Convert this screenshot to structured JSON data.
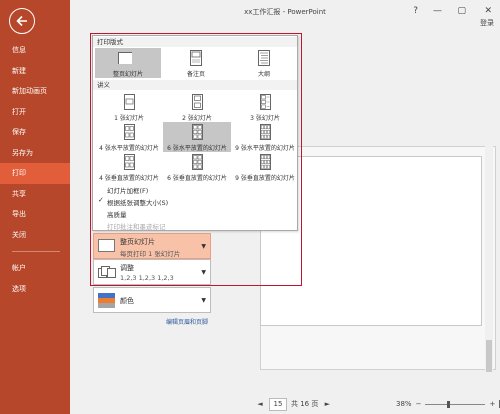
{
  "window": {
    "title": "xx工作汇报 - PowerPoint",
    "help": "?",
    "minimize": "—",
    "restore": "▢",
    "close": "✕",
    "login": "登录"
  },
  "sidebar": {
    "back_icon": "back-arrow-icon",
    "items": [
      "信息",
      "新建",
      "新加动画页",
      "打开",
      "保存",
      "另存为",
      "打印",
      "共享",
      "导出",
      "关闭"
    ],
    "active_index": 6,
    "bottom_items": [
      "帐户",
      "选项"
    ]
  },
  "popup": {
    "print_layout_header": "打印版式",
    "print_layout_options": [
      {
        "label": "整页幻灯片",
        "icon": "full-page-slide-icon"
      },
      {
        "label": "备注页",
        "icon": "notes-page-icon"
      },
      {
        "label": "大纲",
        "icon": "outline-icon"
      }
    ],
    "print_layout_selected": 0,
    "handouts_header": "讲义",
    "handout_options": [
      "1 张幻灯片",
      "2 张幻灯片",
      "3 张幻灯片",
      "4 张水平放置的幻灯片",
      "6 张水平放置的幻灯片",
      "9 张水平放置的幻灯片",
      "4 张垂直放置的幻灯片",
      "6 张垂直放置的幻灯片",
      "9 张垂直放置的幻灯片"
    ],
    "handout_selected": 4,
    "menu_options": [
      {
        "label": "幻灯片加框(F)",
        "checked": false,
        "disabled": false
      },
      {
        "label": "根据纸张调整大小(S)",
        "checked": true,
        "disabled": false
      },
      {
        "label": "高质量",
        "checked": false,
        "disabled": false
      },
      {
        "label": "打印批注和墨迹标记",
        "checked": false,
        "disabled": true
      }
    ]
  },
  "settings": {
    "layout": {
      "title": "整页幻灯片",
      "subtitle": "每页打印 1 张幻灯片"
    },
    "collate": {
      "title": "调整",
      "subtitle": "1,2,3    1,2,3    1,2,3"
    },
    "color": {
      "title": "颜色"
    },
    "footer_link": "编辑页眉和页脚"
  },
  "pager": {
    "prev": "◄",
    "current": "15",
    "of_total": "共 16 页",
    "next": "►"
  },
  "zoom": {
    "level": "38%",
    "minus": "−",
    "plus": "+"
  },
  "colors": {
    "accent": "#b7472a",
    "active": "#e25e3a",
    "highlight": "#f8c2a8",
    "annotation": "#c0152d"
  }
}
